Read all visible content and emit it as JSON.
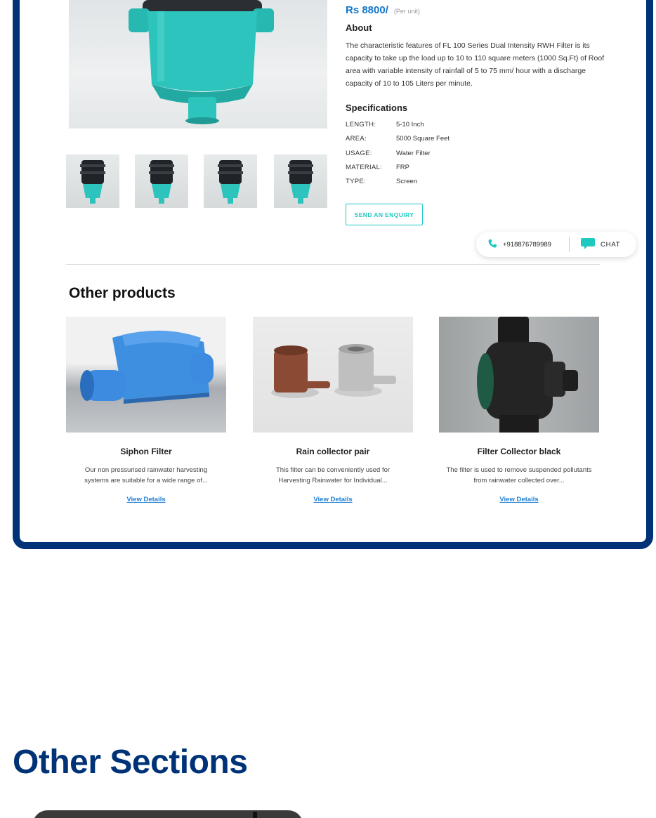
{
  "product": {
    "price": "Rs 8800/",
    "price_unit": "(Per unit)",
    "about_title": "About",
    "about_text": "The characteristic features of FL 100 Series Dual Intensity RWH Filter is its capacity to take up the load up to 10 to 110 square meters (1000 Sq.Ft) of Roof area with variable intensity of rainfall of 5 to 75 mm/ hour with a discharge capacity of 10 to 105 Liters per minute.",
    "specs_title": "Specifications",
    "specs": [
      {
        "key": "LENGTH:",
        "value": "5-10 Inch"
      },
      {
        "key": "AREA:",
        "value": "5000 Square Feet"
      },
      {
        "key": "USAGE:",
        "value": "Water Filter"
      },
      {
        "key": "MATERIAL:",
        "value": "FRP"
      },
      {
        "key": "TYPE:",
        "value": "Screen"
      }
    ],
    "enquiry_label": "SEND AN ENQUIRY"
  },
  "contact": {
    "phone": "+918876789989",
    "chat_label": "CHAT"
  },
  "other_products": {
    "title": "Other products",
    "items": [
      {
        "name": "Siphon Filter",
        "desc": "Our non pressurised rainwater harvesting systems are suitable for a wide range of...",
        "link": "View Details"
      },
      {
        "name": "Rain collector pair",
        "desc": "This filter can be conveniently used for Harvesting Rainwater for Individual...",
        "link": "View Details"
      },
      {
        "name": "Filter Collector black",
        "desc": "The filter is used to remove suspended pollutants from rainwater collected over...",
        "link": "View Details"
      }
    ]
  },
  "page": {
    "section_heading": "Other Sections"
  },
  "colors": {
    "frame_border": "#003277",
    "accent_teal": "#1ec9c0",
    "link_blue": "#1e7fd6",
    "heading_navy": "#003277"
  },
  "icons": [
    "phone-icon",
    "chat-icon"
  ]
}
